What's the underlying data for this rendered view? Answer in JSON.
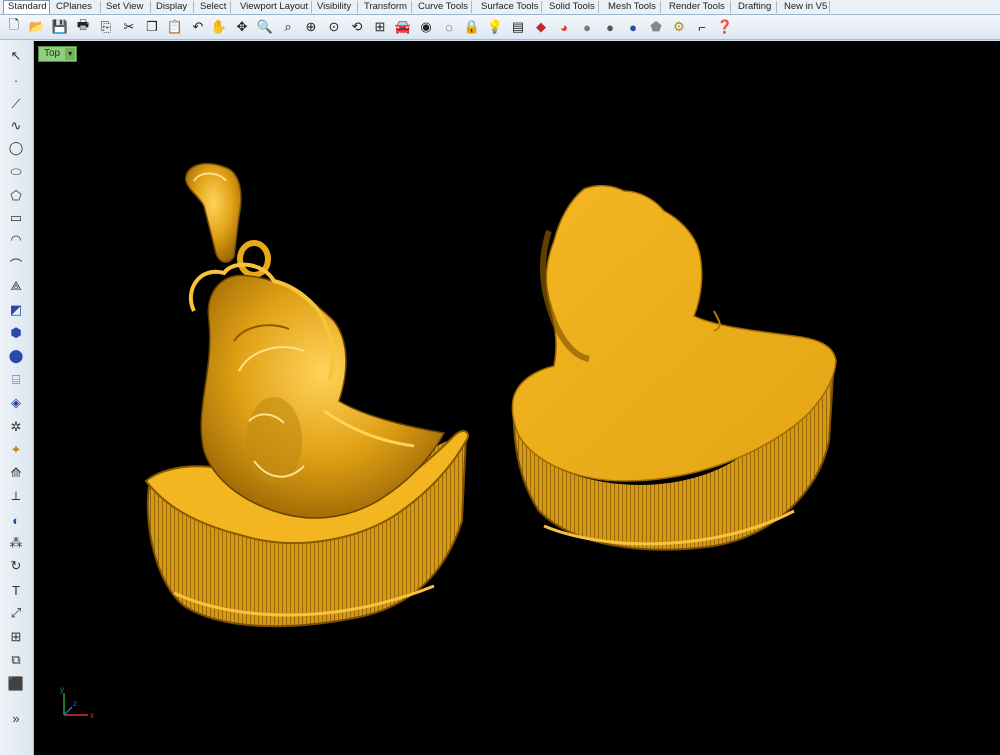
{
  "tabs": [
    {
      "label": "Standard",
      "active": true
    },
    {
      "label": "CPlanes"
    },
    {
      "label": "Set View"
    },
    {
      "label": "Display"
    },
    {
      "label": "Select"
    },
    {
      "label": "Viewport Layout"
    },
    {
      "label": "Visibility"
    },
    {
      "label": "Transform"
    },
    {
      "label": "Curve Tools"
    },
    {
      "label": "Surface Tools"
    },
    {
      "label": "Solid Tools"
    },
    {
      "label": "Mesh Tools"
    },
    {
      "label": "Render Tools"
    },
    {
      "label": "Drafting"
    },
    {
      "label": "New in V5"
    }
  ],
  "toolbar_icons": [
    "new-icon",
    "open-icon",
    "save-icon",
    "print-icon",
    "import-icon",
    "cut-icon",
    "copy-icon",
    "paste-icon",
    "undo-icon",
    "pan-icon",
    "move-icon",
    "zoom-icon",
    "zoom-window-icon",
    "zoom-extents-icon",
    "zoom-selected-icon",
    "rotate-view-icon",
    "four-viewports-icon",
    "car-icon",
    "show-icon",
    "hide-icon",
    "lock-icon",
    "light-icon",
    "layer-icon",
    "material-icon",
    "shade-icon",
    "render-icon",
    "rendered-icon",
    "ghosted-icon",
    "spotlight-icon",
    "options-icon",
    "snap-icon",
    "help-icon"
  ],
  "left_icons": [
    "select-icon",
    "point-icon",
    "polyline-icon",
    "curve-icon",
    "circle-icon",
    "ellipse-icon",
    "polygon-icon",
    "rectangle-icon",
    "arc-icon",
    "fillet-icon",
    "trim-icon",
    "surface-icon",
    "box-icon",
    "sphere-icon",
    "cylinder-icon",
    "extrude-icon",
    "mesh-icon",
    "join-icon",
    "explode-icon",
    "split-icon",
    "boolean-icon",
    "array-icon",
    "rotate-icon",
    "text-icon",
    "dimension-icon",
    "grid-icon",
    "group-icon",
    "render-icon",
    "more-icon"
  ],
  "viewport": {
    "title": "Top",
    "menu_arrow": "▾"
  },
  "axes": {
    "x": "x",
    "y": "y",
    "z": "z"
  },
  "colors": {
    "gold": "#e6a817",
    "gold_dark": "#8a5a00",
    "gold_light": "#ffd24a",
    "viewport_bg": "#000000",
    "title_bg": "#8fcf7f"
  }
}
